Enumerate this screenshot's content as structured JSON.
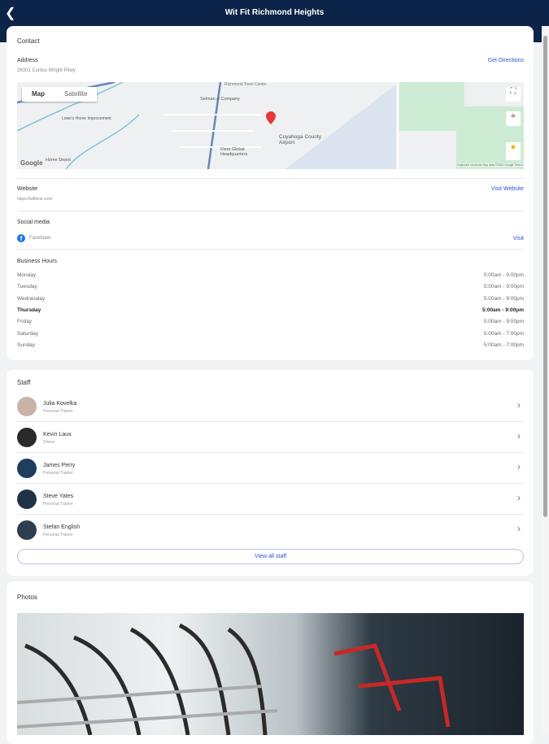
{
  "header": {
    "title": "Wit Fit Richmond Heights",
    "back_icon": "chevron-left-icon"
  },
  "contact": {
    "heading": "Contact",
    "address_label": "Address",
    "address": "26301 Curtiss Wright Pkwy",
    "directions": "Get Directions",
    "map": {
      "tab_map": "Map",
      "tab_satellite": "Satellite",
      "labels": [
        "Selman & Company",
        "Cuyahoga County Airport",
        "Lowe's Home Improvement",
        "Home Depot",
        "Fleet Global Headquarters",
        "Richmond Town Center"
      ],
      "footer": "Keyboard shortcuts   Map data ©2024 Google   Terms",
      "logo": "Google"
    },
    "website_label": "Website",
    "website": "https://witfitcle.com/",
    "visit_website": "Visit Website",
    "social_label": "Social media",
    "facebook": "Facebook",
    "visit": "Visit",
    "hours_label": "Business Hours",
    "hours": [
      {
        "day": "Monday",
        "time": "5:00am - 9:00pm"
      },
      {
        "day": "Tuesday",
        "time": "5:00am - 9:00pm"
      },
      {
        "day": "Wednesday",
        "time": "5:00am - 9:00pm"
      },
      {
        "day": "Thursday",
        "time": "5:00am - 9:00pm"
      },
      {
        "day": "Friday",
        "time": "5:00am - 9:00pm"
      },
      {
        "day": "Saturday",
        "time": "5:00am - 7:00pm"
      },
      {
        "day": "Sunday",
        "time": "5:00am - 7:00pm"
      }
    ]
  },
  "staff": {
    "heading": "Staff",
    "view_all": "View all staff",
    "members": [
      {
        "name": "Julia Kovelka",
        "role": "Personal Trainer",
        "color": "#c9b3a6"
      },
      {
        "name": "Kevin Laux",
        "role": "Owner",
        "color": "#2a2a2a"
      },
      {
        "name": "James Perry",
        "role": "Personal Trainer",
        "color": "#1f3d5c"
      },
      {
        "name": "Steve Yates",
        "role": "Personal Trainer",
        "color": "#1f3346"
      },
      {
        "name": "Stefan English",
        "role": "Personal Trainer",
        "color": "#2c3e50"
      }
    ]
  },
  "photos": {
    "heading": "Photos"
  }
}
